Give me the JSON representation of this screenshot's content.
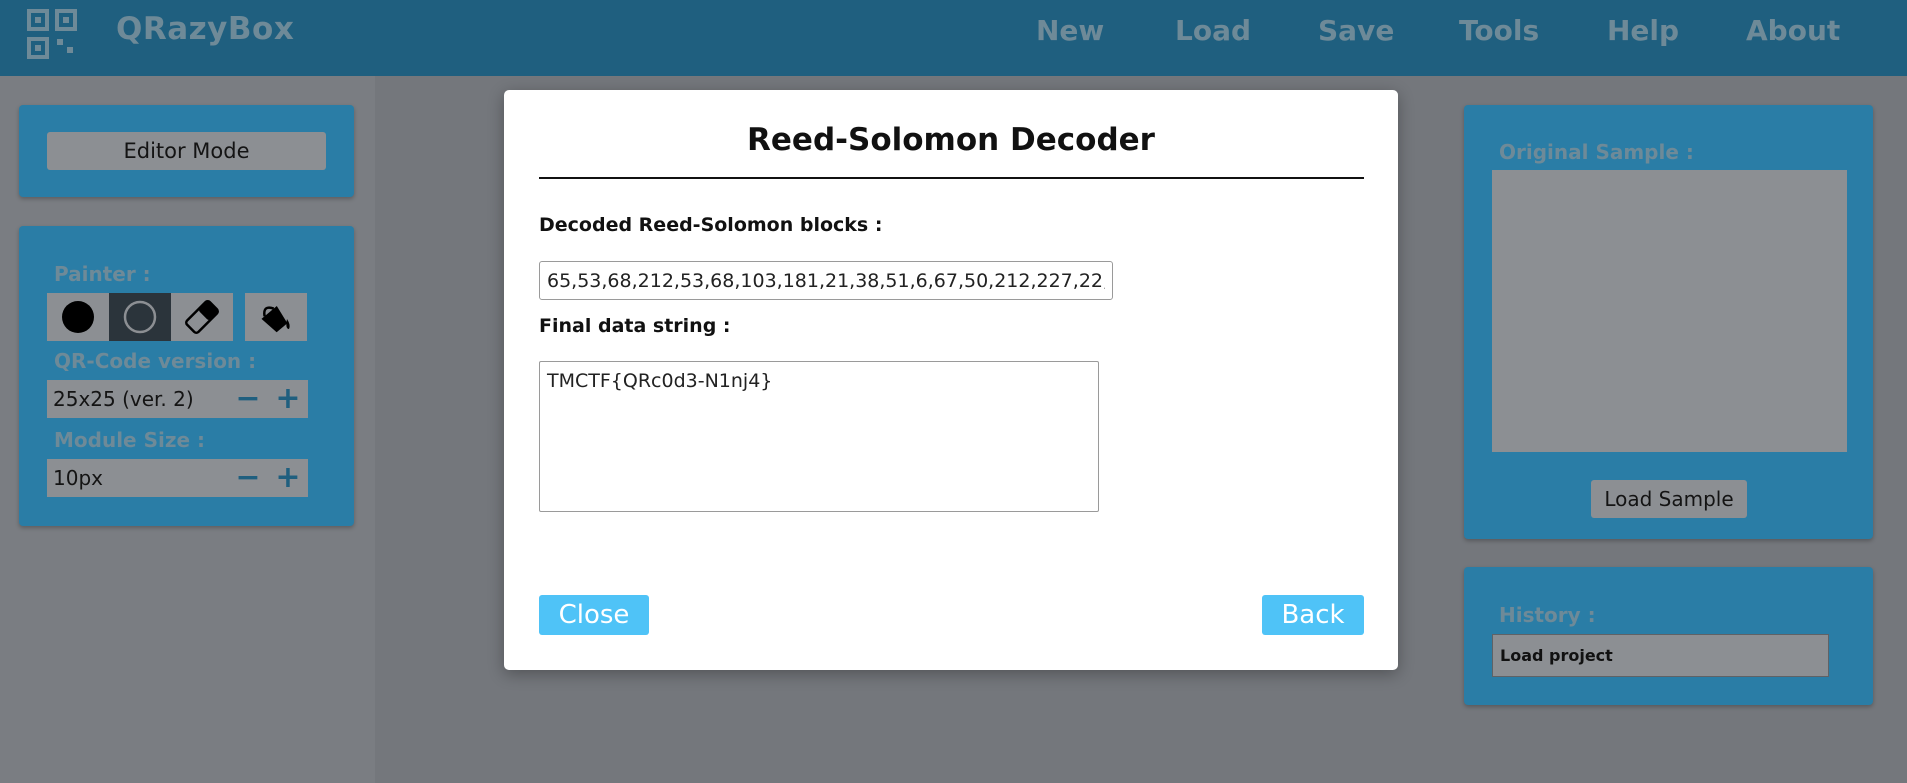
{
  "app": {
    "name": "QRazyBox",
    "nav": [
      "New",
      "Load",
      "Save",
      "Tools",
      "Help",
      "About"
    ]
  },
  "left_panel": {
    "editor_mode_label": "Editor Mode",
    "painter_label": "Painter :",
    "painter_tools": [
      "black-module-icon",
      "white-module-icon",
      "eraser-icon",
      "paint-bucket-icon"
    ],
    "qr_version_label": "QR-Code version :",
    "qr_version_value": "25x25 (ver. 2)",
    "module_size_label": "Module Size :",
    "module_size_value": "10px",
    "minus": "−",
    "plus": "+"
  },
  "modal": {
    "title": "Reed-Solomon Decoder",
    "decoded_label": "Decoded Reed-Solomon blocks :",
    "decoded_value": "65,53,68,212,53,68,103,181,21,38,51,6,67,50,212,227,22,",
    "final_label": "Final data string :",
    "final_value": "TMCTF{QRc0d3-N1nj4}",
    "close_label": "Close",
    "back_label": "Back"
  },
  "right_panel": {
    "original_sample_label": "Original Sample :",
    "load_sample_label": "Load Sample",
    "history_label": "History :",
    "history_items": [
      "Load project"
    ]
  },
  "colors": {
    "topbar": "#1f5f7f",
    "panel": "#2a7da6",
    "modal_button": "#4fc3f7",
    "overlay": "#777a7f"
  }
}
